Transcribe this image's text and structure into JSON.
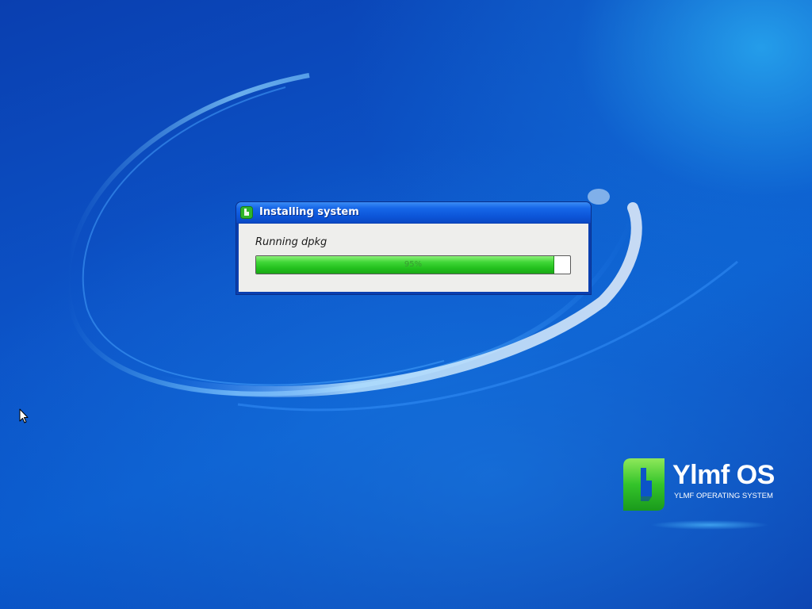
{
  "dialog": {
    "title": "Installing system",
    "status_text": "Running dpkg",
    "progress": {
      "percent": 95,
      "label": "95%"
    }
  },
  "branding": {
    "logo_name": "Ylmf OS",
    "logo_tagline": "YLMF OPERATING SYSTEM",
    "logo_icon": "ylmf-leaf-icon"
  },
  "colors": {
    "desktop_blue": "#0c54c8",
    "title_bar_blue": "#1666e8",
    "progress_green": "#22bf1d",
    "dialog_body": "#eeeeec"
  },
  "icons": {
    "window_icon": "installer-icon",
    "cursor": "mouse-pointer-icon"
  }
}
